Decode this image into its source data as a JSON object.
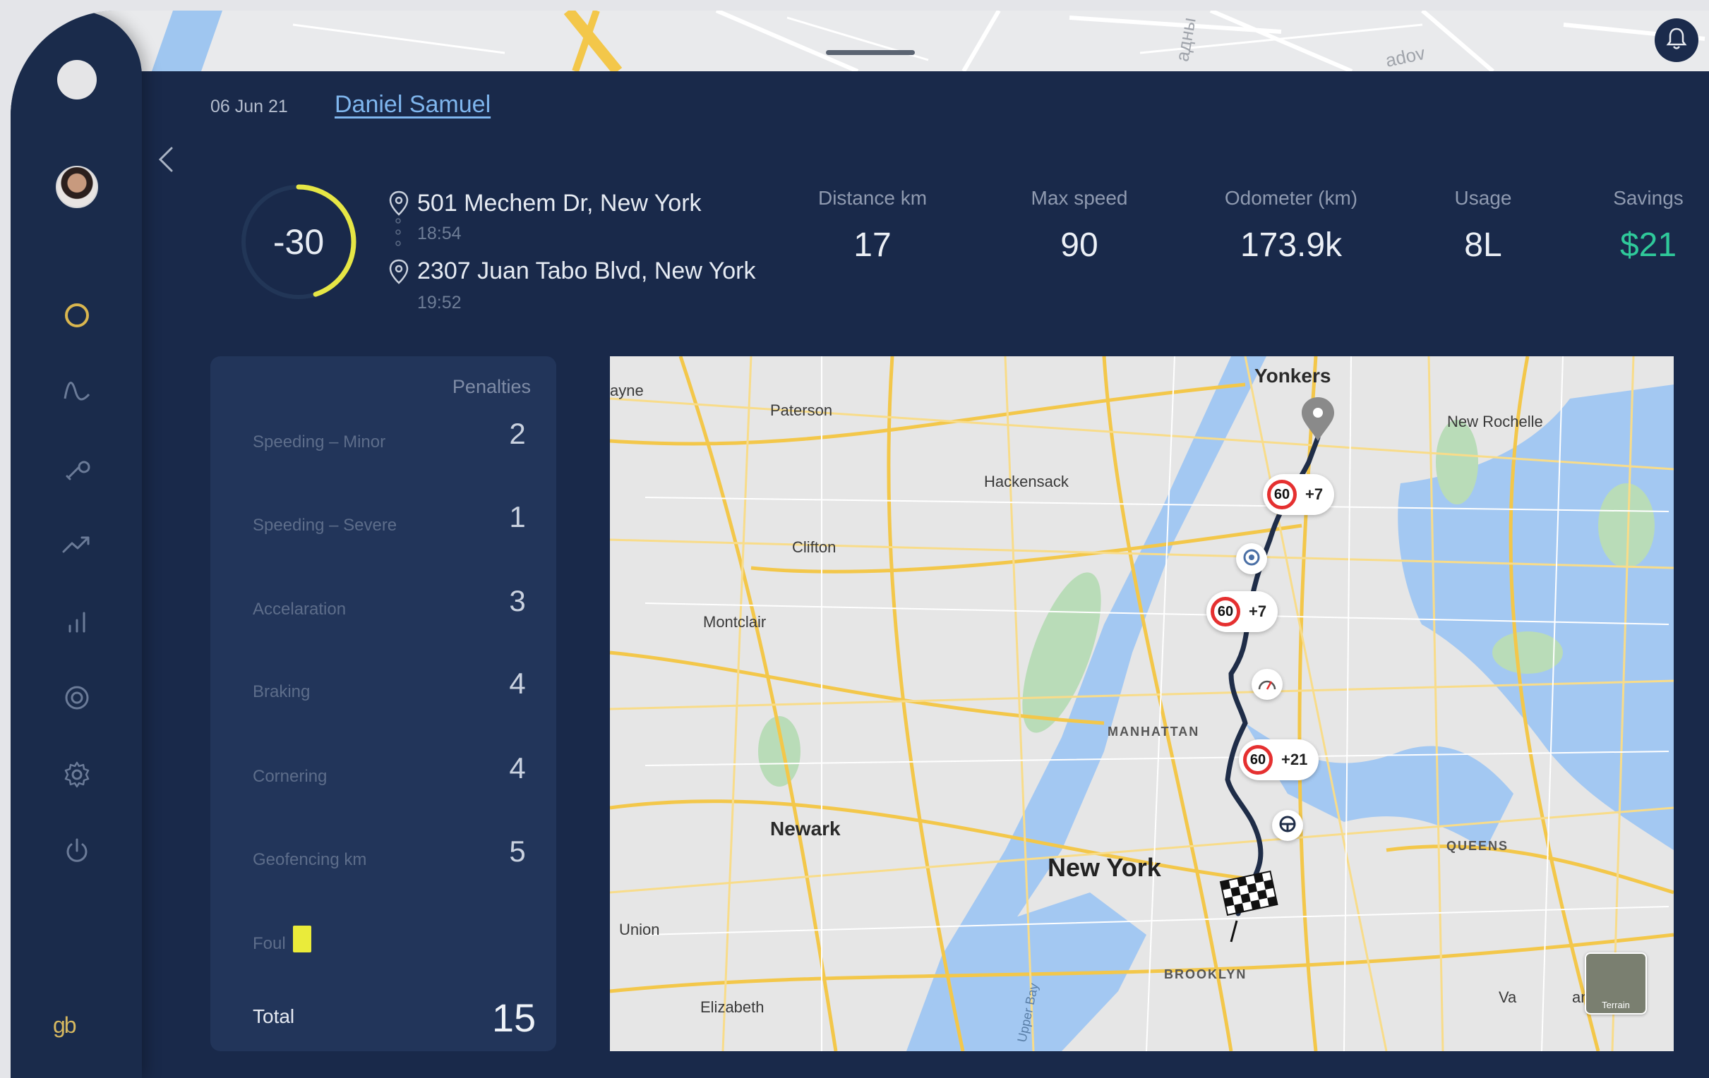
{
  "header": {
    "date": "06 Jun 21",
    "driver_name": "Daniel Samuel"
  },
  "score": {
    "value": "-30",
    "gauge_fraction": 0.45,
    "gauge_color": "#e6e645"
  },
  "trip": {
    "start_address": "501 Mechem Dr, New York",
    "start_time": "18:54",
    "end_address": "2307 Juan Tabo Blvd, New York",
    "end_time": "19:52"
  },
  "stats": [
    {
      "label": "Distance km",
      "value": "17"
    },
    {
      "label": "Max speed",
      "value": "90"
    },
    {
      "label": "Odometer (km)",
      "value": "173.9k"
    },
    {
      "label": "Usage",
      "value": "8L"
    },
    {
      "label": "Savings",
      "value": "$21",
      "color": "#2fc99a"
    }
  ],
  "penalties": {
    "header": "Penalties",
    "rows": [
      {
        "label": "Speeding – Minor",
        "value": "2"
      },
      {
        "label": "Speeding – Severe",
        "value": "1"
      },
      {
        "label": "Accelaration",
        "value": "3"
      },
      {
        "label": "Braking",
        "value": "4"
      },
      {
        "label": "Cornering",
        "value": "4"
      },
      {
        "label": "Geofencing km",
        "value": "5"
      },
      {
        "label": "Foul",
        "value": ""
      }
    ],
    "foul_card_color": "#eaeb3a",
    "total_label": "Total",
    "total_value": "15"
  },
  "map": {
    "places": [
      "ayne",
      "Paterson",
      "Yonkers",
      "New Rochelle",
      "Hackensack",
      "Clifton",
      "Montclair",
      "MANHATTAN",
      "Newark",
      "New York",
      "QUEENS",
      "Union",
      "BROOKLYN",
      "Elizabeth",
      "Upper Bay",
      "Va",
      "am"
    ],
    "speed_events": [
      {
        "limit": "60",
        "over": "+7"
      },
      {
        "limit": "60",
        "over": "+7"
      },
      {
        "limit": "60",
        "over": "+21"
      }
    ],
    "terrain_label": "Terrain"
  },
  "colors": {
    "background": "#19294a",
    "accent_ring": "#d9b64f",
    "link": "#7fb6ee"
  },
  "icons": [
    "bell-icon",
    "back-chevron-icon",
    "dashboard-ring-icon",
    "wave-icon",
    "wrench-icon",
    "trend-icon",
    "bar-chart-icon",
    "target-icon",
    "gear-icon",
    "power-icon"
  ]
}
